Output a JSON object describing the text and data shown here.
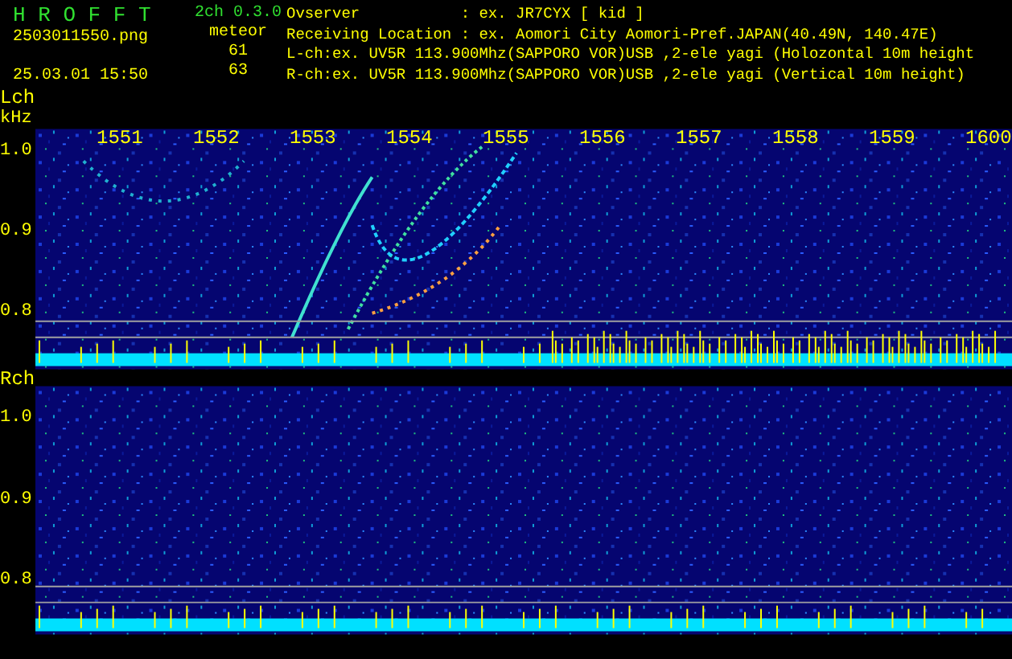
{
  "header": {
    "app_title": "H R O F F T",
    "version": "2ch 0.3.0",
    "filename": "2503011550.png",
    "timestamp": "25.03.01 15:50",
    "meteor_label": "meteor",
    "meteor_counts": [
      "61",
      "63"
    ]
  },
  "info_lines": [
    "Ovserver           : ex. JR7CYX [ kid ]",
    "Receiving Location : ex. Aomori City Aomori-Pref.JAPAN(40.49N, 140.47E)",
    "L-ch:ex. UV5R 113.900Mhz(SAPPORO VOR)USB ,2-ele yagi (Holozontal 10m height",
    "R-ch:ex. UV5R 113.900Mhz(SAPPORO VOR)USB ,2-ele yagi (Vertical 10m height)"
  ],
  "channels": [
    {
      "label": "Lch",
      "unit": "kHz",
      "freq_labels": [
        "1551",
        "1552",
        "1553",
        "1554",
        "1555",
        "1556",
        "1557",
        "1558",
        "1559",
        "1600"
      ],
      "y_labels": [
        "1.0",
        "0.9",
        "0.8"
      ]
    },
    {
      "label": "Rch",
      "y_labels": [
        "1.0",
        "0.9",
        "0.8"
      ]
    }
  ]
}
